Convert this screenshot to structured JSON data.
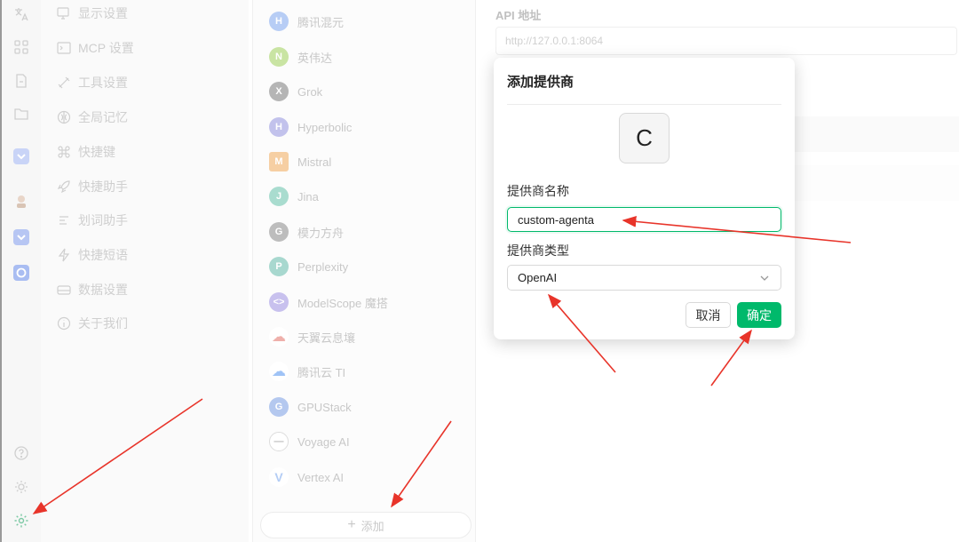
{
  "rail": {
    "icons": [
      "translate-icon",
      "grid-icon",
      "file-icon",
      "folder-icon",
      "app-icon",
      "avatar-icon",
      "app2-icon",
      "app3-icon",
      "help-icon",
      "theme-icon",
      "settings-icon"
    ]
  },
  "menu": {
    "items": [
      {
        "label": "显示设置",
        "icon": "display-icon"
      },
      {
        "label": "MCP 设置",
        "icon": "terminal-icon"
      },
      {
        "label": "工具设置",
        "icon": "tools-icon"
      },
      {
        "label": "全局记忆",
        "icon": "memory-icon"
      },
      {
        "label": "快捷键",
        "icon": "command-icon"
      },
      {
        "label": "快捷助手",
        "icon": "rocket-icon"
      },
      {
        "label": "划词助手",
        "icon": "select-text-icon"
      },
      {
        "label": "快捷短语",
        "icon": "zap-icon"
      },
      {
        "label": "数据设置",
        "icon": "database-icon"
      },
      {
        "label": "关于我们",
        "icon": "info-icon"
      }
    ]
  },
  "providers": {
    "items": [
      {
        "name": "腾讯混元",
        "color": "#4c8cf0",
        "glyph": "H"
      },
      {
        "name": "英伟达",
        "color": "#76b900",
        "glyph": "N"
      },
      {
        "name": "Grok",
        "color": "#444444",
        "glyph": "X"
      },
      {
        "name": "Hyperbolic",
        "color": "#5b5bd6",
        "glyph": "H"
      },
      {
        "name": "Mistral",
        "color": "#f7a04b",
        "glyph": "M"
      },
      {
        "name": "Jina",
        "color": "#0b9c7d",
        "glyph": "J"
      },
      {
        "name": "模力方舟",
        "color": "#555555",
        "glyph": "G"
      },
      {
        "name": "Perplexity",
        "color": "#1f8f7e",
        "glyph": "P"
      },
      {
        "name": "ModelScope 魔搭",
        "color": "#6b5bd6",
        "glyph": "<>"
      },
      {
        "name": "天翼云息壤",
        "color": "#e0473e",
        "glyph": "☁"
      },
      {
        "name": "腾讯云 TI",
        "color": "#2f7df0",
        "glyph": "☁"
      },
      {
        "name": "GPUStack",
        "color": "#3a6ed8",
        "glyph": "G"
      },
      {
        "name": "Voyage AI",
        "color": "#888888",
        "glyph": "—"
      },
      {
        "name": "Vertex AI",
        "color": "#4285f4",
        "glyph": "V"
      }
    ],
    "add_label": "添加"
  },
  "right": {
    "api_label": "API 地址",
    "api_placeholder": "http://127.0.0.1:8064"
  },
  "modal": {
    "title": "添加提供商",
    "avatar_letter": "C",
    "name_label": "提供商名称",
    "name_value": "custom-agenta",
    "type_label": "提供商类型",
    "type_value": "OpenAI",
    "cancel_label": "取消",
    "ok_label": "确定"
  },
  "colors": {
    "accent": "#00b96b",
    "annotation_arrow": "#e8342a"
  }
}
